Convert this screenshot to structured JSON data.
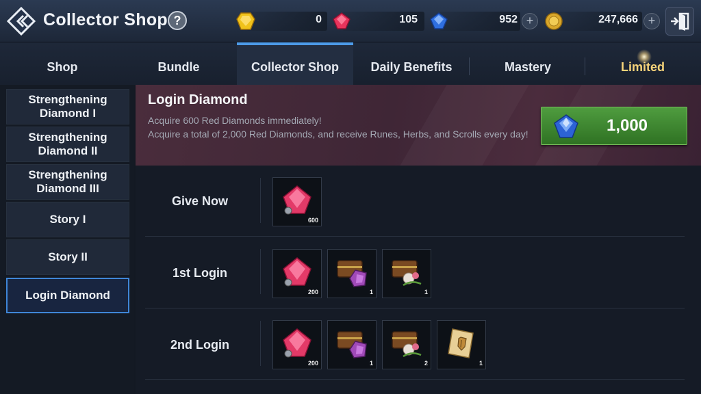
{
  "header": {
    "title": "Collector Shop",
    "help_label": "?",
    "currencies": [
      {
        "icon": "gold-gem-icon",
        "value": "0"
      },
      {
        "icon": "red-diamond-icon",
        "value": "105"
      },
      {
        "icon": "blue-diamond-icon",
        "value": "952"
      },
      {
        "icon": "gold-coin-icon",
        "value": "247,666"
      }
    ],
    "plus_label": "+"
  },
  "tabs": [
    {
      "label": "Shop",
      "active": false
    },
    {
      "label": "Bundle",
      "active": false
    },
    {
      "label": "Collector Shop",
      "active": true
    },
    {
      "label": "Daily Benefits",
      "active": false
    },
    {
      "label": "Mastery",
      "active": false
    },
    {
      "label": "Limited",
      "active": false
    }
  ],
  "sidebar": {
    "items": [
      {
        "label": "Strengthening Diamond I"
      },
      {
        "label": "Strengthening Diamond II"
      },
      {
        "label": "Strengthening Diamond III"
      },
      {
        "label": "Story I"
      },
      {
        "label": "Story II"
      },
      {
        "label": "Login Diamond",
        "active": true
      }
    ]
  },
  "banner": {
    "title": "Login Diamond",
    "desc_line1": "Acquire 600 Red Diamonds immediately!",
    "desc_line2": "Acquire a total of 2,000 Red Diamonds, and receive Runes, Herbs, and Scrolls every day!",
    "price": "1,000",
    "price_icon": "blue-diamond-icon"
  },
  "rows": [
    {
      "label": "Give Now",
      "items": [
        {
          "icon": "red-diamond-icon",
          "qty": "600"
        }
      ]
    },
    {
      "label": "1st Login",
      "items": [
        {
          "icon": "rune-chest-icon",
          "qty": "200",
          "kind": "red-diamond-icon"
        },
        {
          "icon": "rune-chest-icon",
          "qty": "1"
        },
        {
          "icon": "herb-chest-icon",
          "qty": "1"
        }
      ]
    },
    {
      "label": "2nd Login",
      "items": [
        {
          "icon": "red-diamond-icon",
          "qty": "200"
        },
        {
          "icon": "rune-chest-icon",
          "qty": "1"
        },
        {
          "icon": "herb-chest-icon",
          "qty": "2"
        },
        {
          "icon": "scroll-icon",
          "qty": "1"
        }
      ]
    }
  ]
}
